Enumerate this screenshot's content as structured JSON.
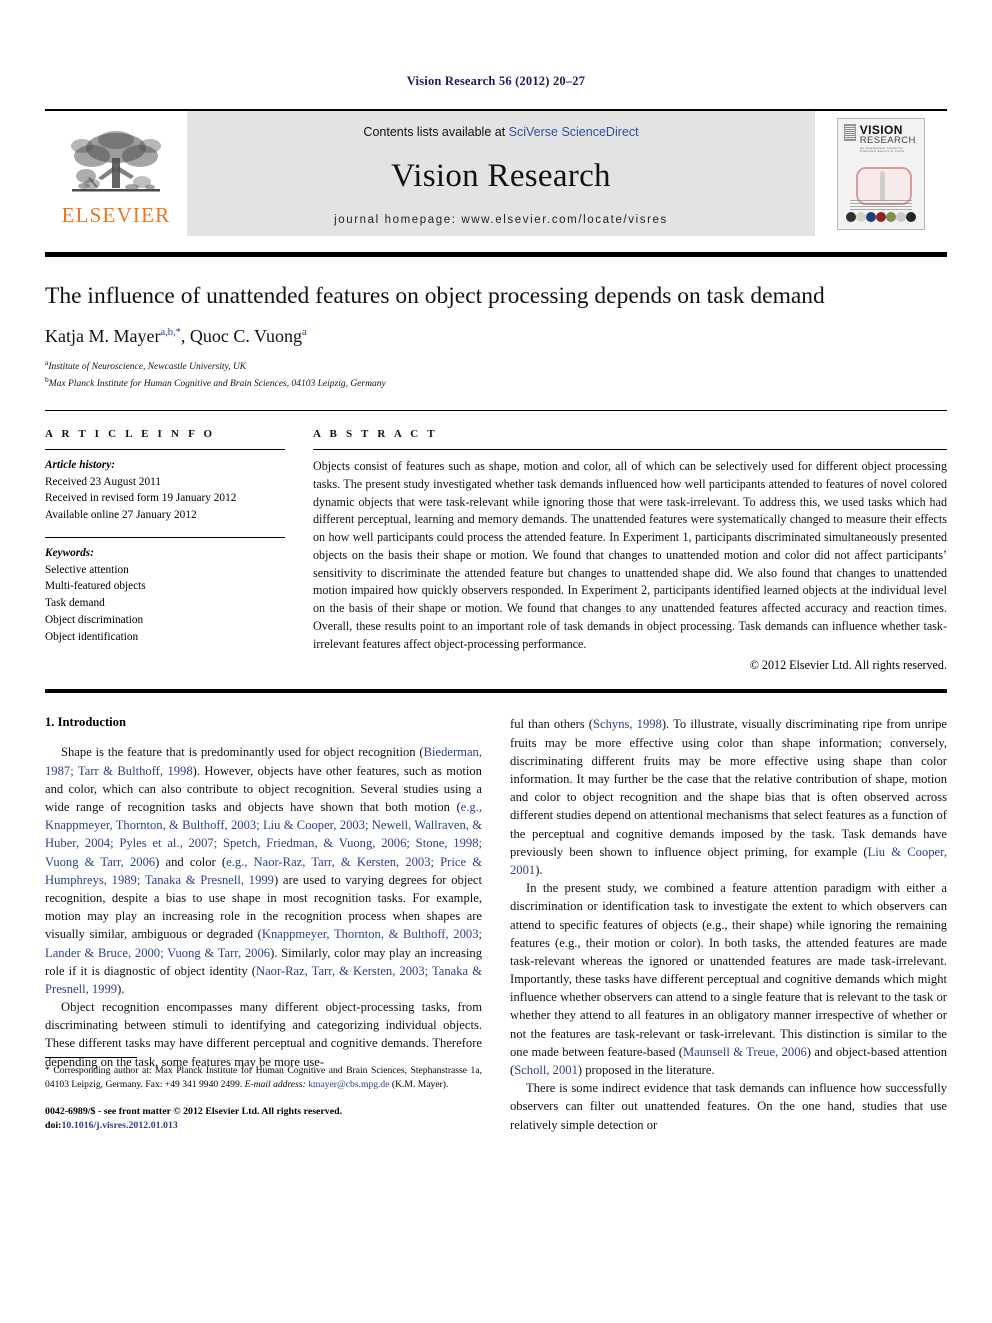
{
  "running_head": "Vision Research 56 (2012) 20–27",
  "masthead": {
    "publisher_logo_text": "ELSEVIER",
    "contents_prefix": "Contents lists available at ",
    "contents_link": "SciVerse ScienceDirect",
    "journal_name": "Vision Research",
    "homepage": "journal homepage: www.elsevier.com/locate/visres",
    "cover": {
      "title_line1": "VISION",
      "title_line2": "RESEARCH",
      "subtitle": "An International Journal for Functional Aspects of Vision"
    },
    "accent_orange": "#E87722",
    "link_blue": "#2b4fa2",
    "band_gray": "#e3e3e3"
  },
  "article": {
    "title": "The influence of unattended features on object processing depends on task demand",
    "authors_html": "Katja M. Mayer<sup>a,b,*</sup>, Quoc C. Vuong<sup>a</sup>",
    "affiliation_a": "Institute of Neuroscience, Newcastle University, UK",
    "affiliation_b": "Max Planck Institute for Human Cognitive and Brain Sciences, 04103 Leipzig, Germany",
    "affil_a_marker": "a",
    "affil_b_marker": "b"
  },
  "article_info": {
    "heading": "A R T I C L E    I N F O",
    "history_label": "Article history:",
    "history": [
      "Received 23 August 2011",
      "Received in revised form 19 January 2012",
      "Available online 27 January 2012"
    ],
    "keywords_label": "Keywords:",
    "keywords": [
      "Selective attention",
      "Multi-featured objects",
      "Task demand",
      "Object discrimination",
      "Object identification"
    ]
  },
  "abstract": {
    "heading": "A B S T R A C T",
    "text": "Objects consist of features such as shape, motion and color, all of which can be selectively used for different object processing tasks. The present study investigated whether task demands influenced how well participants attended to features of novel colored dynamic objects that were task-relevant while ignoring those that were task-irrelevant. To address this, we used tasks which had different perceptual, learning and memory demands. The unattended features were systematically changed to measure their effects on how well participants could process the attended feature. In Experiment 1, participants discriminated simultaneously presented objects on the basis their shape or motion. We found that changes to unattended motion and color did not affect participants’ sensitivity to discriminate the attended feature but changes to unattended shape did. We also found that changes to unattended motion impaired how quickly observers responded. In Experiment 2, participants identified learned objects at the individual level on the basis of their shape or motion. We found that changes to any unattended features affected accuracy and reaction times. Overall, these results point to an important role of task demands in object processing. Task demands can influence whether task-irrelevant features affect object-processing performance.",
    "copyright": "© 2012 Elsevier Ltd. All rights reserved."
  },
  "body": {
    "section_title": "1. Introduction",
    "left_paragraphs": [
      "Shape is the feature that is predominantly used for object recognition (Biederman, 1987; Tarr & Bulthoff, 1998). However, objects have other features, such as motion and color, which can also contribute to object recognition. Several studies using a wide range of recognition tasks and objects have shown that both motion (e.g., Knappmeyer, Thornton, & Bulthoff, 2003; Liu & Cooper, 2003; Newell, Wallraven, & Huber, 2004; Pyles et al., 2007; Spetch, Friedman, & Vuong, 2006; Stone, 1998; Vuong & Tarr, 2006) and color (e.g., Naor-Raz, Tarr, & Kersten, 2003; Price & Humphreys, 1989; Tanaka & Presnell, 1999) are used to varying degrees for object recognition, despite a bias to use shape in most recognition tasks. For example, motion may play an increasing role in the recognition process when shapes are visually similar, ambiguous or degraded (Knappmeyer, Thornton, & Bulthoff, 2003; Lander & Bruce, 2000; Vuong & Tarr, 2006). Similarly, color may play an increasing role if it is diagnostic of object identity (Naor-Raz, Tarr, & Kersten, 2003; Tanaka & Presnell, 1999).",
      "Object recognition encompasses many different object-processing tasks, from discriminating between stimuli to identifying and categorizing individual objects. These different tasks may have different perceptual and cognitive demands. Therefore depending on the task, some features may be more use-"
    ],
    "right_paragraphs": [
      "ful than others (Schyns, 1998). To illustrate, visually discriminating ripe from unripe fruits may be more effective using color than shape information; conversely, discriminating different fruits may be more effective using shape than color information. It may further be the case that the relative contribution of shape, motion and color to object recognition and the shape bias that is often observed across different studies depend on attentional mechanisms that select features as a function of the perceptual and cognitive demands imposed by the task. Task demands have previously been shown to influence object priming, for example (Liu & Cooper, 2001).",
      "In the present study, we combined a feature attention paradigm with either a discrimination or identification task to investigate the extent to which observers can attend to specific features of objects (e.g., their shape) while ignoring the remaining features (e.g., their motion or color). In both tasks, the attended features are made task-relevant whereas the ignored or unattended features are made task-irrelevant. Importantly, these tasks have different perceptual and cognitive demands which might influence whether observers can attend to a single feature that is relevant to the task or whether they attend to all features in an obligatory manner irrespective of whether or not the features are task-relevant or task-irrelevant. This distinction is similar to the one made between feature-based (Maunsell & Treue, 2006) and object-based attention (Scholl, 2001) proposed in the literature.",
      "There is some indirect evidence that task demands can influence how successfully observers can filter out unattended features. On the one hand, studies that use relatively simple detection or"
    ]
  },
  "footnote": {
    "marker": "*",
    "corresponding": "Corresponding author at: Max Planck Institute for Human Cognitive and Brain Sciences, Stephanstrasse 1a, 04103 Leipzig, Germany. Fax: +49 341 9940 2499.",
    "email_label": "E-mail address:",
    "email": "kmayer@cbs.mpg.de",
    "email_owner": "(K.M. Mayer).",
    "issn_line": "0042-6989/$ - see front matter © 2012 Elsevier Ltd. All rights reserved.",
    "doi_label": "doi:",
    "doi_value": "10.1016/j.visres.2012.01.013"
  }
}
